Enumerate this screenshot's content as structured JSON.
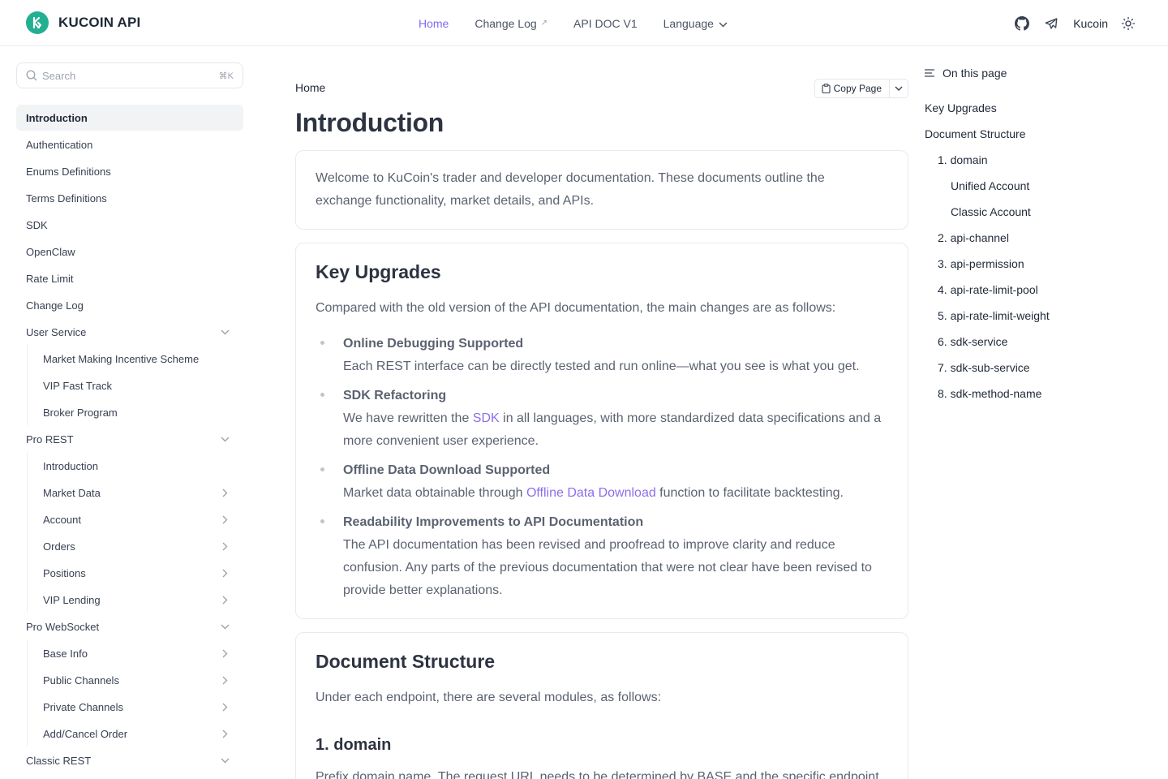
{
  "brand": {
    "name": "KUCOIN API"
  },
  "topnav": {
    "links": [
      {
        "label": "Home"
      },
      {
        "label": "Change Log"
      },
      {
        "label": "API DOC V1"
      },
      {
        "label": "Language"
      }
    ],
    "right_label": "Kucoin",
    "icons": [
      "github-icon",
      "telegram-icon",
      "theme-toggle-icon"
    ],
    "accent_color": "#7c6cf0"
  },
  "search": {
    "placeholder": "Search",
    "shortcut": "⌘K"
  },
  "sidebar": {
    "items": [
      {
        "label": "Introduction"
      },
      {
        "label": "Authentication"
      },
      {
        "label": "Enums Definitions"
      },
      {
        "label": "Terms Definitions"
      },
      {
        "label": "SDK"
      },
      {
        "label": "OpenClaw"
      },
      {
        "label": "Rate Limit"
      },
      {
        "label": "Change Log"
      },
      {
        "label": "User Service"
      },
      {
        "label": "Market Making Incentive Scheme"
      },
      {
        "label": "VIP Fast Track"
      },
      {
        "label": "Broker Program"
      },
      {
        "label": "Pro REST"
      },
      {
        "label": "Introduction"
      },
      {
        "label": "Market Data"
      },
      {
        "label": "Account"
      },
      {
        "label": "Orders"
      },
      {
        "label": "Positions"
      },
      {
        "label": "VIP Lending"
      },
      {
        "label": "Pro WebSocket"
      },
      {
        "label": "Base Info"
      },
      {
        "label": "Public Channels"
      },
      {
        "label": "Private Channels"
      },
      {
        "label": "Add/Cancel Order"
      },
      {
        "label": "Classic REST"
      }
    ]
  },
  "main": {
    "breadcrumb": "Home",
    "copy_label": "Copy Page",
    "title": "Introduction",
    "welcome": "Welcome to KuCoin's trader and developer documentation. These documents outline the exchange functionality, market details, and APIs.",
    "key_upgrades": {
      "heading": "Key Upgrades",
      "intro": "Compared with the old version of the API documentation, the main changes are as follows:",
      "items": [
        {
          "title": "Online Debugging Supported",
          "desc": "Each REST interface can be directly tested and run online—what you see is what you get."
        },
        {
          "title": "SDK Refactoring",
          "desc_pre": "We have rewritten the ",
          "link": "SDK",
          "desc_post": " in all languages, with more standardized data specifications and a more convenient user experience."
        },
        {
          "title": "Offline Data Download Supported",
          "desc_pre": "Market data obtainable through ",
          "link": "Offline Data Download",
          "desc_post": " function to facilitate backtesting."
        },
        {
          "title": "Readability Improvements to API Documentation",
          "desc": "The API documentation has been revised and proofread to improve clarity and reduce confusion. Any parts of the previous documentation that were not clear have been revised to provide better explanations."
        }
      ]
    },
    "doc_structure": {
      "heading": "Document Structure",
      "intro": "Under each endpoint, there are several modules, as follows:",
      "sub_heading": "1. domain",
      "partial_text": "Prefix domain name. The request URL needs to be determined by BASE and the specific endpoint"
    }
  },
  "toc": {
    "heading": "On this page",
    "items": [
      {
        "label": "Key Upgrades"
      },
      {
        "label": "Document Structure"
      },
      {
        "label": "1. domain"
      },
      {
        "label": "Unified Account"
      },
      {
        "label": "Classic Account"
      },
      {
        "label": "2. api-channel"
      },
      {
        "label": "3. api-permission"
      },
      {
        "label": "4. api-rate-limit-pool"
      },
      {
        "label": "5. api-rate-limit-weight"
      },
      {
        "label": "6. sdk-service"
      },
      {
        "label": "7. sdk-sub-service"
      },
      {
        "label": "8. sdk-method-name"
      }
    ]
  }
}
